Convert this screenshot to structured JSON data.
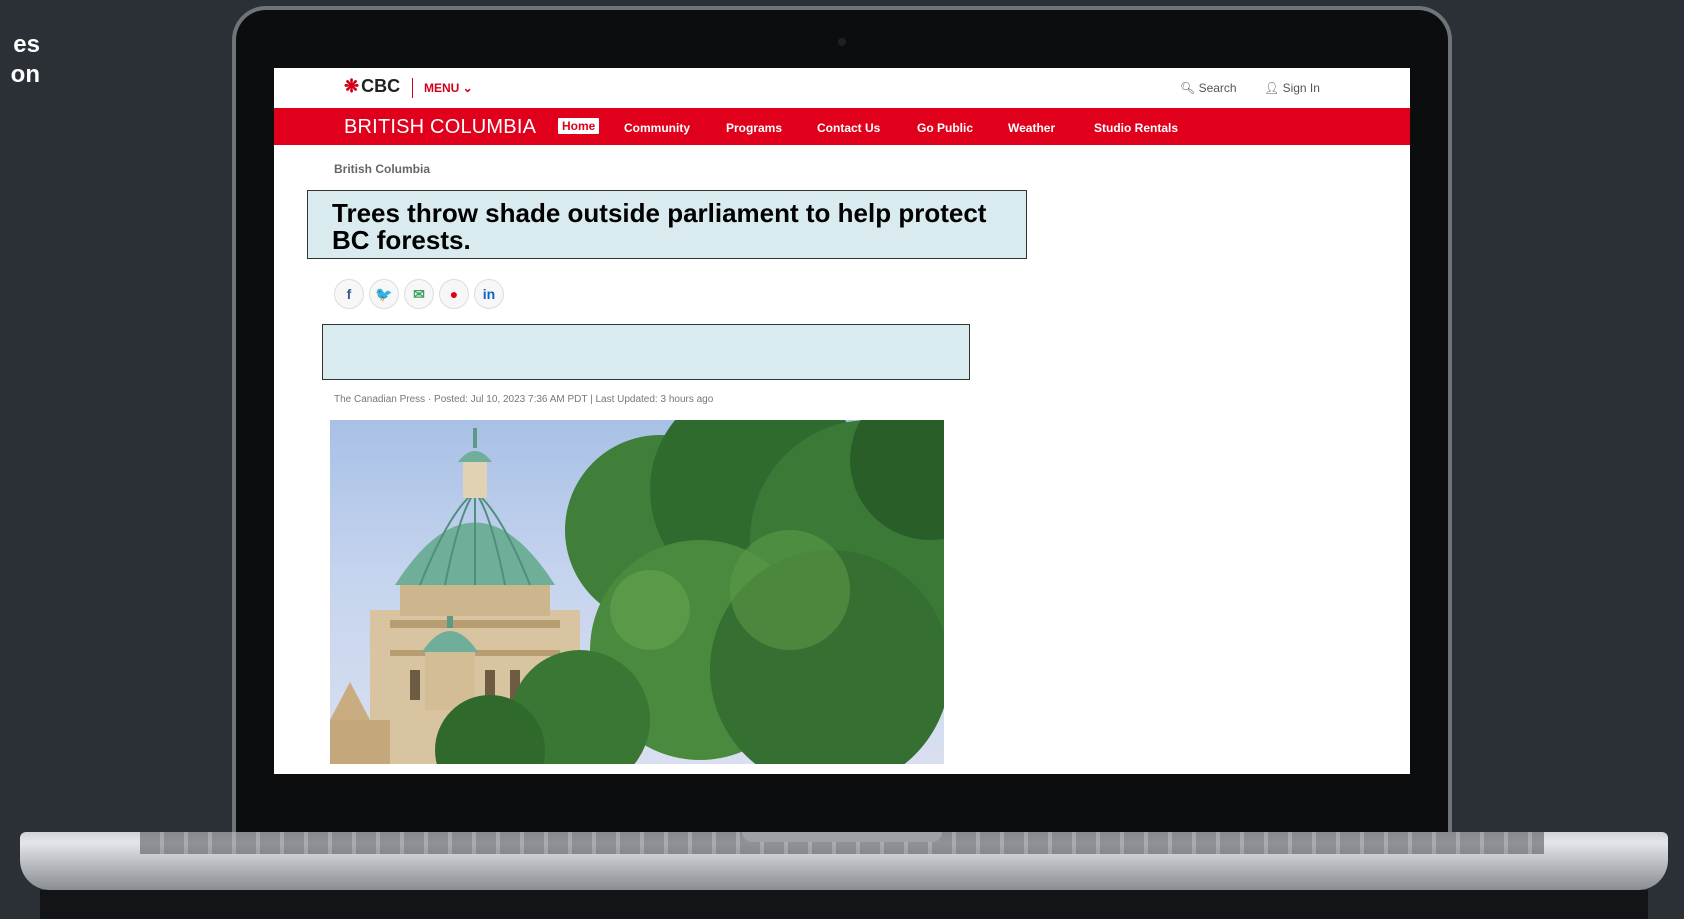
{
  "corner_text": {
    "line1": "es",
    "line2": "on"
  },
  "site": {
    "logo": "CBC",
    "menu": "MENU ⌄",
    "search": "Search",
    "sign_in": "Sign In"
  },
  "nav": {
    "region": "BRITISH COLUMBIA",
    "items": [
      {
        "label": "Home",
        "active": true
      },
      {
        "label": "Community",
        "active": false
      },
      {
        "label": "Programs",
        "active": false
      },
      {
        "label": "Contact Us",
        "active": false
      },
      {
        "label": "Go Public",
        "active": false
      },
      {
        "label": "Weather",
        "active": false
      },
      {
        "label": "Studio Rentals",
        "active": false
      }
    ]
  },
  "article": {
    "breadcrumb": "British Columbia",
    "headline": "Trees throw shade outside parliament to help protect BC forests.",
    "byline": "The Canadian Press · Posted: Jul 10, 2023 7:36 AM PDT | Last Updated: 3 hours ago",
    "share_icons": [
      "facebook-icon",
      "twitter-icon",
      "email-icon",
      "reddit-icon",
      "linkedin-icon"
    ],
    "share_glyphs": [
      "f",
      "🐦",
      "✉",
      "●",
      "in"
    ]
  },
  "colors": {
    "brand_red": "#e0001b",
    "highlight_box": "#d9ebee"
  }
}
